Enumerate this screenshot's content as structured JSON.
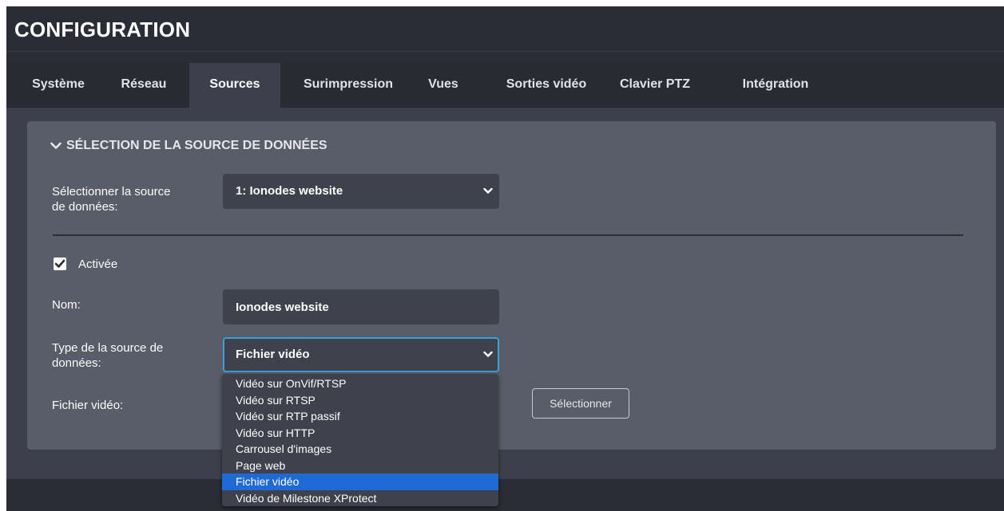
{
  "header": {
    "title": "CONFIGURATION"
  },
  "tabs": [
    {
      "label": "Système",
      "active": false
    },
    {
      "label": "Réseau",
      "active": false
    },
    {
      "label": "Sources",
      "active": true
    },
    {
      "label": "Surimpression",
      "active": false
    },
    {
      "label": "Vues",
      "active": false
    },
    {
      "label": "Sorties vidéo",
      "active": false
    },
    {
      "label": "Clavier PTZ",
      "active": false
    },
    {
      "label": "Intégration",
      "active": false
    }
  ],
  "section": {
    "title": "SÉLECTION DE LA SOURCE DE DONNÉES",
    "icon": "chevron-down-icon"
  },
  "form": {
    "source_select_label_line1": "Sélectionner la source",
    "source_select_label_line2": "de données:",
    "source_select_value": "1: Ionodes website",
    "enabled_label": "Activée",
    "enabled_checked": true,
    "name_label": "Nom:",
    "name_value": "Ionodes website",
    "type_label_line1": "Type de la source de",
    "type_label_line2": "données:",
    "type_value": "Fichier vidéo",
    "file_label": "Fichier vidéo:",
    "select_button": "Sélectionner"
  },
  "type_options": [
    "Vidéo sur OnVif/RTSP",
    "Vidéo sur RTSP",
    "Vidéo sur RTP passif",
    "Vidéo sur HTTP",
    "Carrousel d'images",
    "Page web",
    "Fichier vidéo",
    "Vidéo de Milestone XProtect"
  ],
  "type_selected_index": 6,
  "colors": {
    "accent_focus": "#3b9fd8",
    "option_highlight": "#1f6ad4",
    "app_bg": "#2b2d36",
    "panel_bg": "#595c69"
  }
}
